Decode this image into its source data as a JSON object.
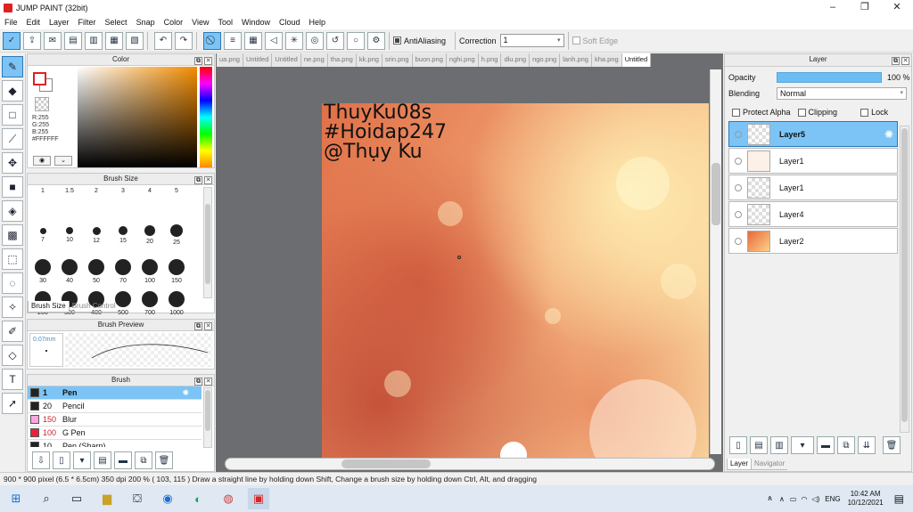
{
  "window": {
    "title": "JUMP PAINT (32bit)",
    "minimize": "–",
    "maximize": "❐",
    "close": "✕"
  },
  "menu": [
    "File",
    "Edit",
    "Layer",
    "Filter",
    "Select",
    "Snap",
    "Color",
    "View",
    "Tool",
    "Window",
    "Cloud",
    "Help"
  ],
  "toolbar": {
    "antialiasing_label": "AntiAliasing",
    "correction_label": "Correction",
    "correction_value": "1",
    "soft_edge_label": "Soft Edge"
  },
  "color_panel": {
    "title": "Color",
    "r": "R:255",
    "g": "G:255",
    "b": "B:255",
    "hex": "#FFFFFF"
  },
  "brush_size_panel": {
    "title": "Brush Size",
    "sizes": [
      "1",
      "1.5",
      "2",
      "3",
      "4",
      "5",
      "7",
      "10",
      "12",
      "15",
      "20",
      "25",
      "30",
      "40",
      "50",
      "70",
      "100",
      "150",
      "200",
      "300",
      "400",
      "500",
      "700",
      "1000"
    ],
    "tab_active": "Brush Size",
    "tab_inactive": "Brush Control"
  },
  "brush_preview_panel": {
    "title": "Brush Preview",
    "size_readout": "0.07mm"
  },
  "brush_panel": {
    "title": "Brush",
    "items": [
      {
        "num": "1",
        "name": "Pen",
        "color": "#222222"
      },
      {
        "num": "20",
        "name": "Pencil",
        "color": "#222222"
      },
      {
        "num": "150",
        "name": "Blur",
        "color": "#f7a8e0"
      },
      {
        "num": "100",
        "name": "G Pen",
        "color": "#e8213a"
      },
      {
        "num": "10",
        "name": "Pen (Sharp)",
        "color": "#222222"
      }
    ]
  },
  "file_tabs": [
    "ua.png",
    "Untitled",
    "Untitled",
    "ne.png",
    "tha.png",
    "kk.png",
    "srin.png",
    "buon.png",
    "nghi.png",
    "h.png",
    "dlu.png",
    "ngo.png",
    "lanh.png",
    "kha.png",
    "Untitled"
  ],
  "canvas": {
    "watermark": [
      "ThuyKu08s",
      "#Hoidap247",
      "@Thụy Ku"
    ]
  },
  "layer_panel": {
    "title": "Layer",
    "opacity_label": "Opacity",
    "opacity_value": "100 %",
    "opacity_fraction": 1.0,
    "blending_label": "Blending",
    "blending_value": "Normal",
    "protect_alpha_label": "Protect Alpha",
    "clipping_label": "Clipping",
    "lock_label": "Lock",
    "layers": [
      "Layer5",
      "Layer1",
      "Layer1",
      "Layer4",
      "Layer2"
    ],
    "tab_active": "Layer",
    "tab_inactive": "Navigator"
  },
  "status": {
    "text": "900 * 900 pixel  (6.5 * 6.5cm)  350 dpi  200 %  ( 103, 115 )  Draw a straight line by holding down Shift, Change a brush size by holding down Ctrl, Alt, and dragging"
  },
  "taskbar": {
    "lang": "ENG",
    "time": "10:42 AM",
    "date": "10/12/2021"
  },
  "colors": {
    "accent": "#7cc4f6",
    "accent_border": "#2a7ab8"
  }
}
